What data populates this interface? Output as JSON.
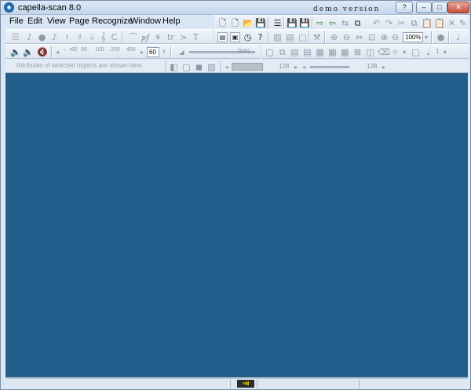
{
  "window": {
    "title": "capella-scan 8.0",
    "demo_label": "demo version",
    "help_btn": "?",
    "min_btn": "–",
    "max_btn": "□",
    "close_btn": "✕"
  },
  "menu": {
    "items": [
      "File",
      "Edit",
      "View",
      "Page",
      "Recognize",
      "Window",
      "Help"
    ]
  },
  "toolbar2": {
    "symbols": [
      "𝄚",
      "♪",
      "●",
      "♪",
      "𝄽",
      "♯",
      "♭",
      "𝄞",
      "C",
      "⌒",
      "𝆏𝆑",
      "𝄋",
      "tr",
      ">",
      "T"
    ]
  },
  "toolbar3": {
    "scale_labels": [
      "30",
      "50",
      "100",
      "200",
      "400"
    ],
    "tempo_value": "60",
    "volume_pct": "90%"
  },
  "toolbar_right": {
    "zoom_value": "100%",
    "value_a": "128",
    "value_b": "128",
    "small_value": "1"
  },
  "info": {
    "text": "Attributes of selected objects are shown here."
  },
  "status": {
    "indicator": "⌨N"
  },
  "colors": {
    "workspace": "#225e8b",
    "chrome": "#d9e6f4"
  }
}
